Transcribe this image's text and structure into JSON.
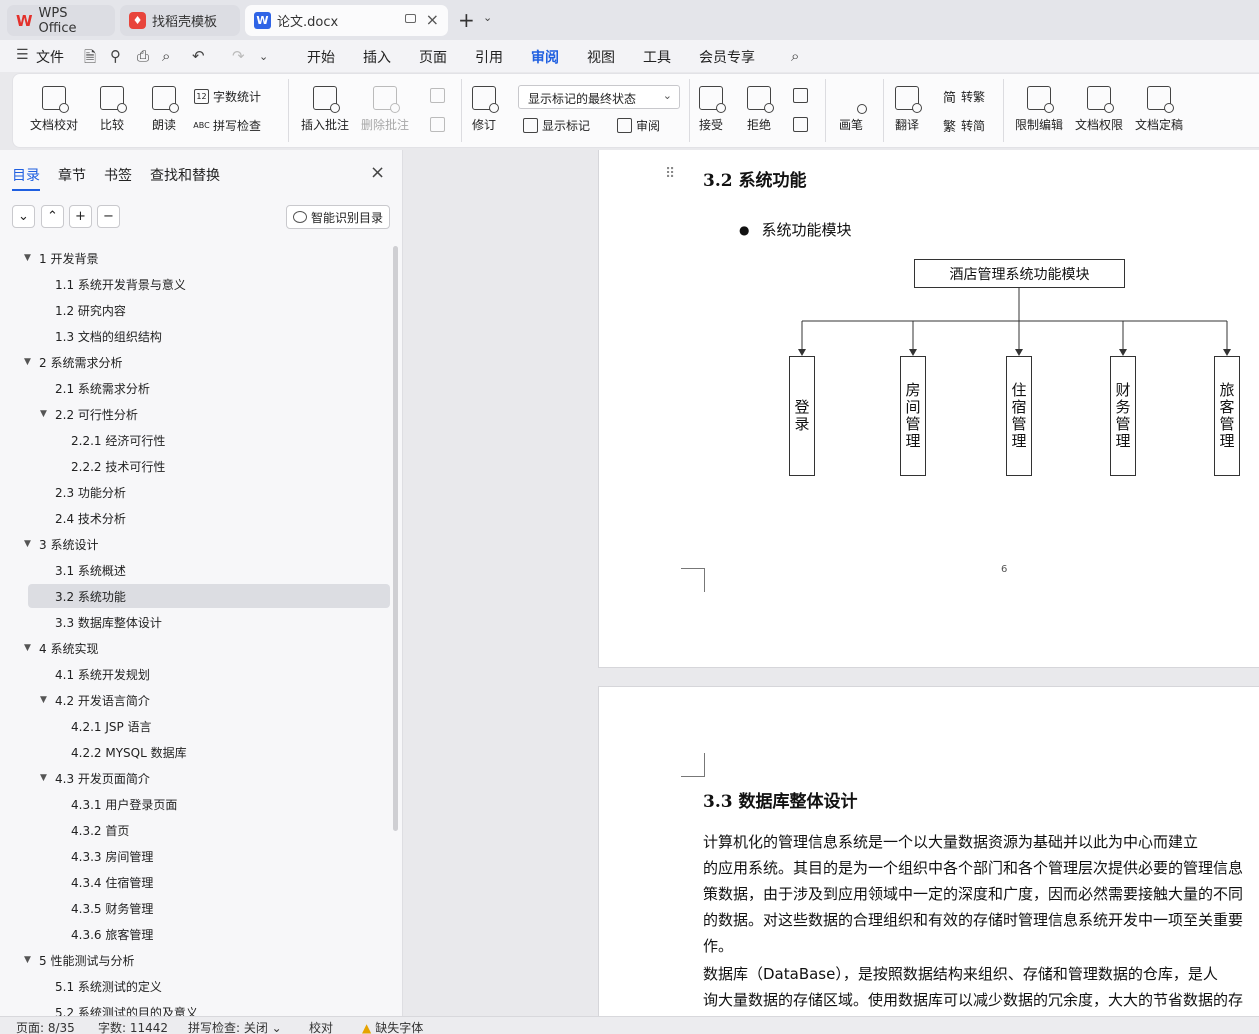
{
  "tabs": {
    "wps": "WPS Office",
    "daoke": "找稻壳模板",
    "doc": "论文.docx"
  },
  "menu": {
    "file": "文件",
    "items": [
      "开始",
      "插入",
      "页面",
      "引用",
      "审阅",
      "视图",
      "工具",
      "会员专享"
    ],
    "active": "审阅"
  },
  "ribbon": {
    "doc_check": "文档校对",
    "compare": "比较",
    "read_aloud": "朗读",
    "word_count": "字数统计",
    "spell_check": "拼写检查",
    "insert_comment": "插入批注",
    "delete_comment": "删除批注",
    "revise": "修订",
    "markup_dropdown": "显示标记的最终状态",
    "show_markup": "显示标记",
    "review": "审阅",
    "accept": "接受",
    "reject": "拒绝",
    "pen": "画笔",
    "translate": "翻译",
    "to_traditional": "转繁",
    "to_simplified": "转简",
    "restrict_edit": "限制编辑",
    "doc_permission": "文档权限",
    "doc_finalize": "文档定稿"
  },
  "sidebar": {
    "tabs": [
      "目录",
      "章节",
      "书签",
      "查找和替换"
    ],
    "active_tab": "目录",
    "smart_btn": "智能识别目录",
    "toc": [
      {
        "label": "1  开发背景",
        "level": 1,
        "caret": true
      },
      {
        "label": "1.1  系统开发背景与意义",
        "level": 2
      },
      {
        "label": "1.2  研究内容",
        "level": 2
      },
      {
        "label": "1.3  文档的组织结构",
        "level": 2
      },
      {
        "label": "2  系统需求分析",
        "level": 1,
        "caret": true
      },
      {
        "label": "2.1  系统需求分析",
        "level": 2
      },
      {
        "label": "2.2 可行性分析",
        "level": 2,
        "caret": true
      },
      {
        "label": "2.2.1 经济可行性",
        "level": 3
      },
      {
        "label": "2.2.2 技术可行性",
        "level": 3
      },
      {
        "label": "2.3 功能分析",
        "level": 2
      },
      {
        "label": "2.4  技术分析",
        "level": 2
      },
      {
        "label": "3  系统设计",
        "level": 1,
        "caret": true
      },
      {
        "label": "3.1  系统概述",
        "level": 2
      },
      {
        "label": "3.2  系统功能",
        "level": 2,
        "selected": true
      },
      {
        "label": "3.3  数据库整体设计",
        "level": 2
      },
      {
        "label": "4  系统实现",
        "level": 1,
        "caret": true
      },
      {
        "label": "4.1  系统开发规划",
        "level": 2
      },
      {
        "label": "4.2  开发语言简介",
        "level": 2,
        "caret": true
      },
      {
        "label": "4.2.1 JSP 语言",
        "level": 3
      },
      {
        "label": "4.2.2 MYSQL 数据库",
        "level": 3
      },
      {
        "label": "4.3  开发页面简介",
        "level": 2,
        "caret": true
      },
      {
        "label": "4.3.1 用户登录页面",
        "level": 3
      },
      {
        "label": "4.3.2 首页",
        "level": 3
      },
      {
        "label": "4.3.3 房间管理",
        "level": 3
      },
      {
        "label": "4.3.4 住宿管理",
        "level": 3
      },
      {
        "label": "4.3.5 财务管理",
        "level": 3
      },
      {
        "label": "4.3.6 旅客管理",
        "level": 3
      },
      {
        "label": "5  性能测试与分析",
        "level": 1,
        "caret": true
      },
      {
        "label": "5.1  系统测试的定义",
        "level": 2
      },
      {
        "label": "5.2  系统测试的目的及意义",
        "level": 2
      }
    ]
  },
  "document": {
    "page1": {
      "heading": "3.2  系统功能",
      "bullet": "系统功能模块",
      "diagram_title": "酒店管理系统功能模块",
      "modules": [
        "登录",
        "房间管理",
        "住宿管理",
        "财务管理",
        "旅客管理"
      ],
      "page_number": "6"
    },
    "page2": {
      "heading": "3.3  数据库整体设计",
      "lines": [
        "        计算机化的管理信息系统是一个以大量数据资源为基础并以此为中心而建立",
        "的应用系统。其目的是为一个组织中各个部门和各个管理层次提供必要的管理信息",
        "策数据，由于涉及到应用领域中一定的深度和广度，因而必然需要接触大量的不同",
        "的数据。对这些数据的合理组织和有效的存储时管理信息系统开发中一项至关重要",
        "作。",
        "        数据库（DataBase），是按照数据结构来组织、存储和管理数据的仓库，是人",
        "询大量数据的存储区域。使用数据库可以减少数据的冗余度，大大的节省数据的存"
      ]
    }
  },
  "status": {
    "page": "页面: 8/35",
    "words": "字数: 11442",
    "spell": "拼写检查: 关闭",
    "proof": "校对",
    "missing_font": "缺失字体"
  }
}
